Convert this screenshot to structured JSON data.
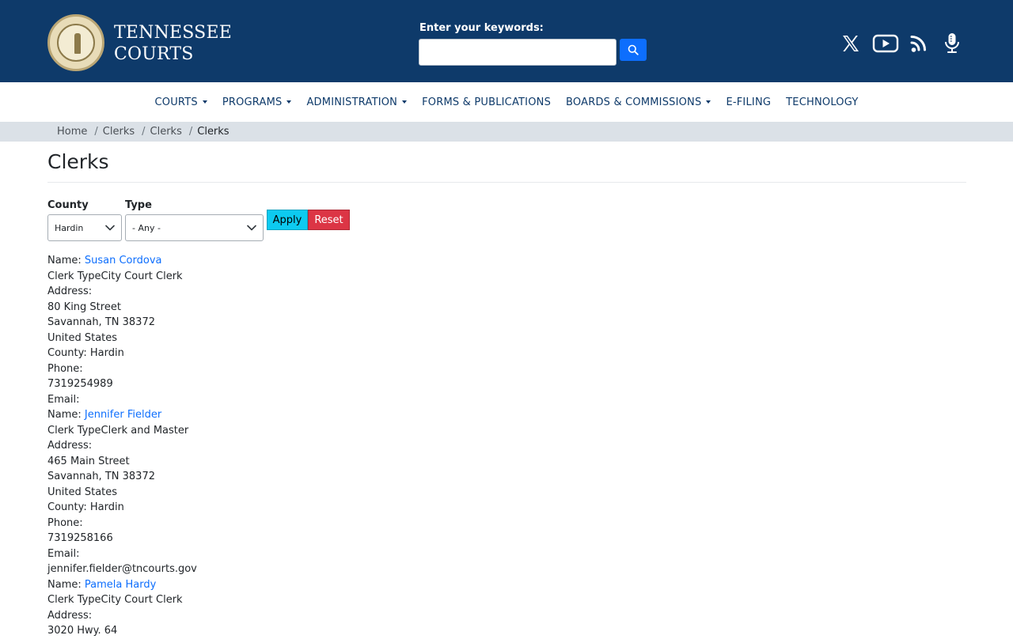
{
  "header": {
    "brand_line1": "TENNESSEE",
    "brand_line2": "COURTS",
    "search_label": "Enter your keywords:",
    "search_value": "",
    "colors": {
      "header_bg": "#0e3a6a",
      "search_button": "#0d6efd"
    }
  },
  "social": {
    "icons": [
      "x-icon",
      "youtube-icon",
      "rss-icon",
      "podcast-microphone-icon"
    ]
  },
  "nav": {
    "items": [
      {
        "label": "COURTS",
        "dropdown": true
      },
      {
        "label": "PROGRAMS",
        "dropdown": true
      },
      {
        "label": "ADMINISTRATION",
        "dropdown": true
      },
      {
        "label": "FORMS & PUBLICATIONS",
        "dropdown": false
      },
      {
        "label": "BOARDS & COMMISSIONS",
        "dropdown": true
      },
      {
        "label": "E-FILING",
        "dropdown": false
      },
      {
        "label": "TECHNOLOGY",
        "dropdown": false
      }
    ]
  },
  "breadcrumb": {
    "items": [
      "Home",
      "Clerks",
      "Clerks"
    ],
    "current": "Clerks"
  },
  "page": {
    "title": "Clerks"
  },
  "filters": {
    "county_label": "County",
    "county_value": "Hardin",
    "type_label": "Type",
    "type_value": "- Any -",
    "apply_label": "Apply",
    "reset_label": "Reset",
    "colors": {
      "apply": "#0dcaf0",
      "reset": "#dc3545"
    }
  },
  "clerks": [
    {
      "name_prefix": "Name: ",
      "name": "Susan Cordova",
      "clerk_type": "Clerk TypeCity Court Clerk",
      "address_label": "Address:",
      "street": "80 King Street",
      "city_line": "Savannah, TN 38372",
      "country": "United States",
      "county": "County: Hardin",
      "phone_label": "Phone:",
      "phone": "7319254989",
      "email_label": "Email:",
      "email": ""
    },
    {
      "name_prefix": "Name: ",
      "name": "Jennifer Fielder",
      "clerk_type": "Clerk TypeClerk and Master",
      "address_label": "Address:",
      "street": "465 Main Street",
      "city_line": "Savannah, TN 38372",
      "country": "United States",
      "county": "County: Hardin",
      "phone_label": "Phone:",
      "phone": "7319258166",
      "email_label": "Email:",
      "email": "jennifer.fielder@tncourts.gov"
    },
    {
      "name_prefix": "Name: ",
      "name": "Pamela Hardy",
      "clerk_type": "Clerk TypeCity Court Clerk",
      "address_label": "Address:",
      "street": "3020 Hwy. 64"
    }
  ]
}
